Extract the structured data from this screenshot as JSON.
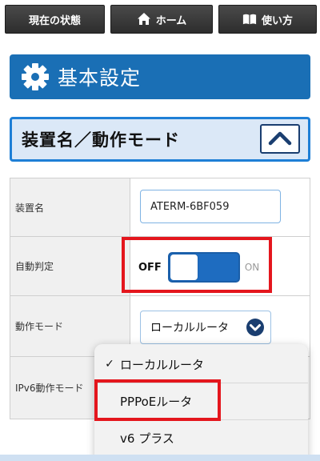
{
  "nav": {
    "status_label": "現在の状態",
    "home_label": "ホーム",
    "help_label": "使い方"
  },
  "header": {
    "title": "基本設定"
  },
  "section": {
    "title": "装置名／動作モード"
  },
  "settings": {
    "device_name": {
      "label": "装置名",
      "value": "ATERM-6BF059"
    },
    "auto_detect": {
      "label": "自動判定",
      "off_label": "OFF",
      "on_label": "ON",
      "state": "OFF"
    },
    "operation_mode": {
      "label": "動作モード",
      "selected": "ローカルルータ"
    },
    "ipv6_mode": {
      "label": "IPv6動作モード"
    }
  },
  "dropdown": {
    "options": [
      {
        "label": "ローカルルータ",
        "checked": true
      },
      {
        "label": "PPPoEルータ",
        "checked": false
      },
      {
        "label": "v6 プラス",
        "checked": false
      }
    ],
    "check_mark": "✓"
  },
  "colors": {
    "nav_bg": "#333333",
    "header_blue": "#1a6fb5",
    "section_border": "#1e7fd6",
    "section_bg": "#dbe8f7",
    "highlight_red": "#e4161d",
    "toggle_blue": "#1e6cc0"
  },
  "icons": {
    "home": "home-icon",
    "help": "book-icon",
    "settings": "gear-icon",
    "collapse": "chevron-up-icon",
    "select": "chevron-down-icon",
    "check": "check-icon"
  }
}
